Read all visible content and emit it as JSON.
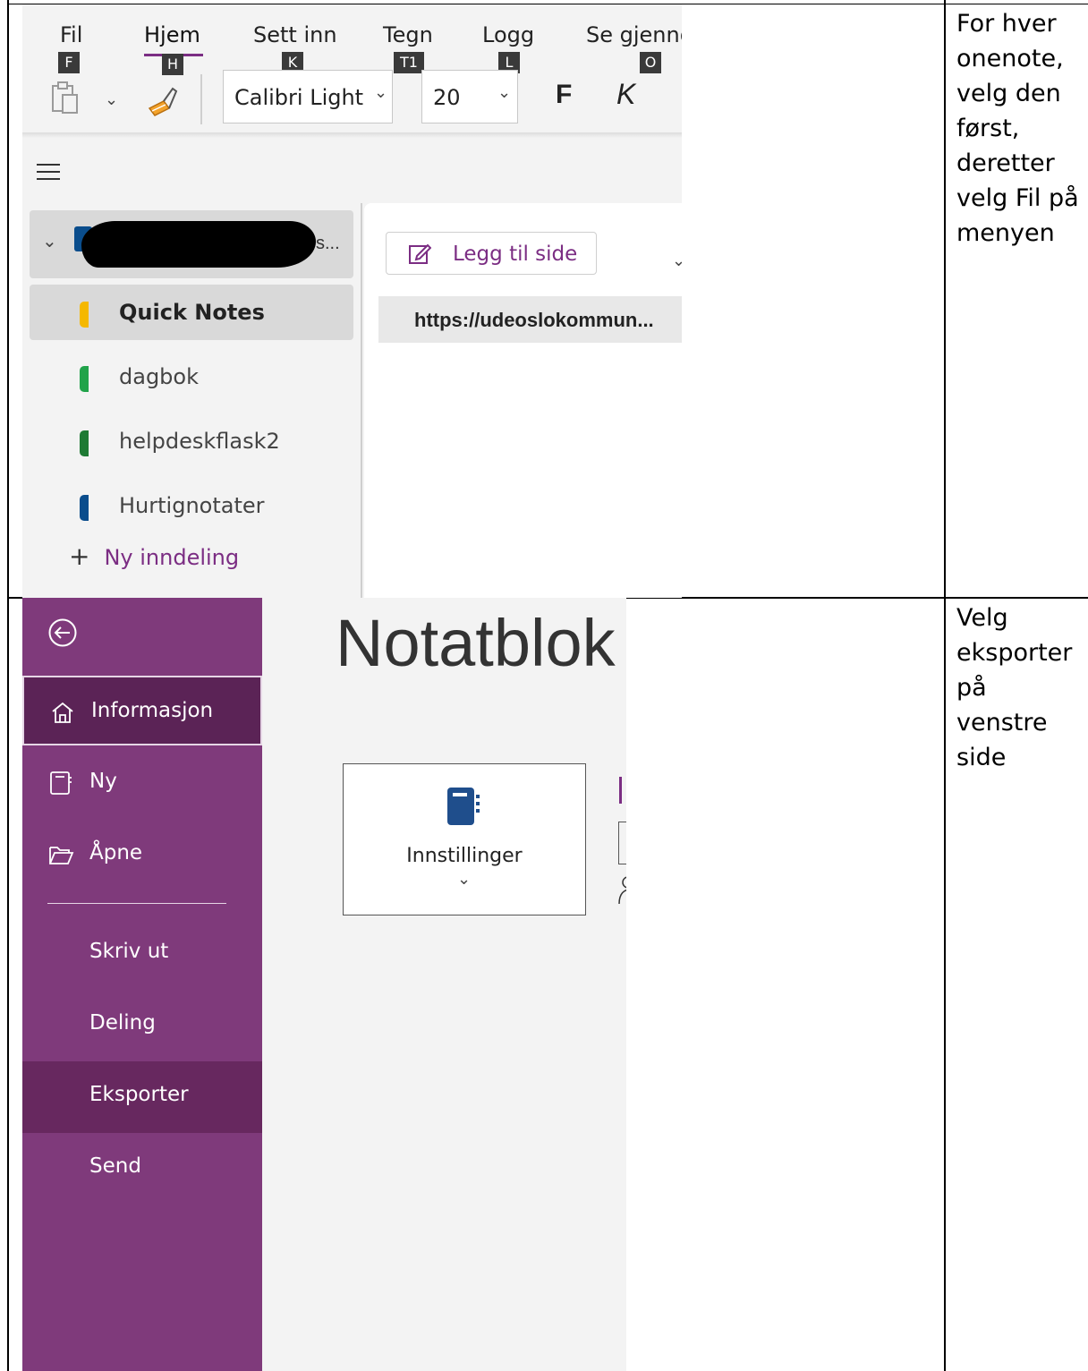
{
  "ribbon": {
    "tabs": [
      {
        "label": "Fil",
        "key": "F"
      },
      {
        "label": "Hjem",
        "key": "H"
      },
      {
        "label": "Sett inn",
        "key": "K"
      },
      {
        "label": "Tegn",
        "key": "T1"
      },
      {
        "label": "Logg",
        "key": "L"
      },
      {
        "label": "Se gjenno",
        "key": "O"
      }
    ],
    "font_name": "Calibri Light",
    "font_size": "20",
    "bold_label": "F",
    "italic_label": "K"
  },
  "notebook": {
    "name_suffix": "s...",
    "add_page_label": "Legg til side",
    "page_title": "https://udeoslokommun...",
    "sections": [
      {
        "label": "Quick Notes",
        "color": "#f5b800",
        "selected": true
      },
      {
        "label": "dagbok",
        "color": "#21a34a"
      },
      {
        "label": "helpdeskflask2",
        "color": "#1e7a34"
      },
      {
        "label": "Hurtignotater",
        "color": "#0a4d8c"
      }
    ],
    "new_section_label": "Ny inndeling"
  },
  "backstage": {
    "page_heading": "Notatblok",
    "nav": {
      "info": "Informasjon",
      "new": "Ny",
      "open": "Åpne",
      "print": "Skriv ut",
      "share": "Deling",
      "export": "Eksporter",
      "send": "Send"
    },
    "settings_label": "Innstillinger",
    "accent": "#7f3a7b",
    "accent_dark": "#5b2356"
  },
  "instructions": {
    "step1": "For hver onenote, velg den først, deretter velg Fil på menyen",
    "step2": "Velg eksporter på venstre side"
  }
}
